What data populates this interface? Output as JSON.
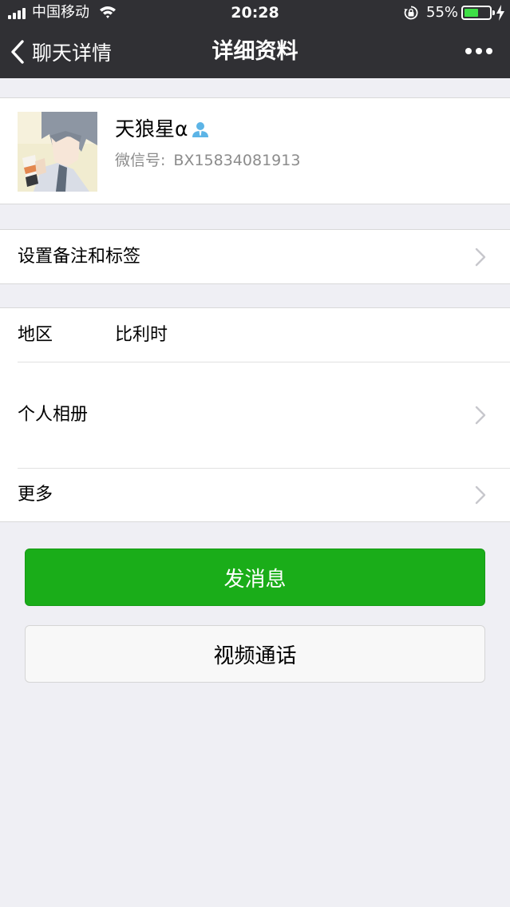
{
  "status_bar": {
    "carrier": "中国移动",
    "time": "20:28",
    "battery_percent": "55%",
    "battery_level": 0.55
  },
  "nav": {
    "back_label": "聊天详情",
    "title": "详细资料"
  },
  "profile": {
    "nickname": "天狼星α",
    "wechat_id_label": "微信号:",
    "wechat_id": "BX15834081913"
  },
  "cells": {
    "remark": {
      "label": "设置备注和标签"
    },
    "region": {
      "label": "地区",
      "value": "比利时"
    },
    "album": {
      "label": "个人相册"
    },
    "more": {
      "label": "更多"
    }
  },
  "buttons": {
    "send_message": "发消息",
    "video_call": "视频通话"
  },
  "colors": {
    "nav_bg": "#303034",
    "page_bg": "#efeff4",
    "primary_green": "#1aad19",
    "secondary_text": "#8c8c8c"
  }
}
